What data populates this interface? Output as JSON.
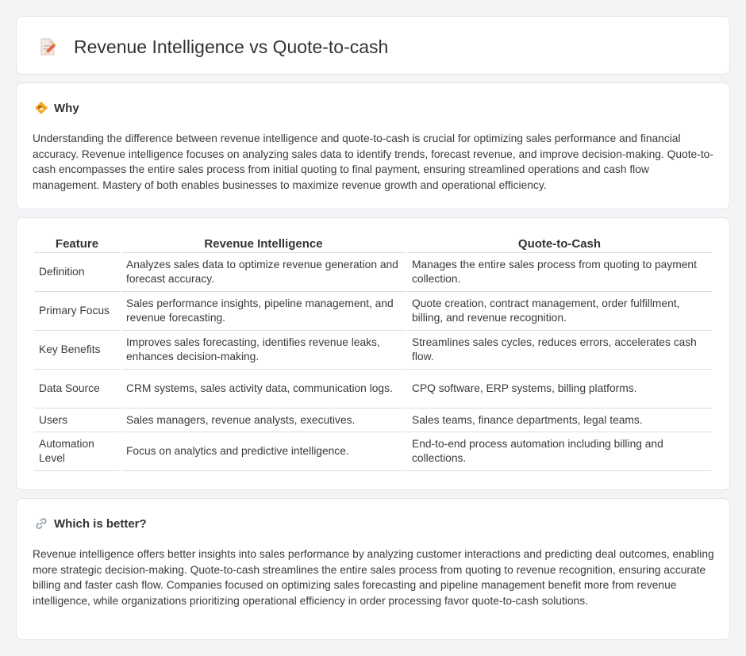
{
  "header": {
    "title": "Revenue Intelligence vs Quote-to-cash",
    "icon": "document-pencil-icon"
  },
  "why": {
    "title": "Why",
    "icon": "diamond-sign-icon",
    "text": "Understanding the difference between revenue intelligence and quote-to-cash is crucial for optimizing sales performance and financial accuracy. Revenue intelligence focuses on analyzing sales data to identify trends, forecast revenue, and improve decision-making. Quote-to-cash encompasses the entire sales process from initial quoting to final payment, ensuring streamlined operations and cash flow management. Mastery of both enables businesses to maximize revenue growth and operational efficiency."
  },
  "table": {
    "headers": [
      "Feature",
      "Revenue Intelligence",
      "Quote-to-Cash"
    ],
    "rows": [
      [
        "Definition",
        "Analyzes sales data to optimize revenue generation and forecast accuracy.",
        "Manages the entire sales process from quoting to payment collection."
      ],
      [
        "Primary Focus",
        "Sales performance insights, pipeline management, and revenue forecasting.",
        "Quote creation, contract management, order fulfillment, billing, and revenue recognition."
      ],
      [
        "Key Benefits",
        "Improves sales forecasting, identifies revenue leaks, enhances decision-making.",
        "Streamlines sales cycles, reduces errors, accelerates cash flow."
      ],
      [
        "Data Source",
        "CRM systems, sales activity data, communication logs.",
        "CPQ software, ERP systems, billing platforms."
      ],
      [
        "Users",
        "Sales managers, revenue analysts, executives.",
        "Sales teams, finance departments, legal teams."
      ],
      [
        "Automation Level",
        "Focus on analytics and predictive intelligence.",
        "End-to-end process automation including billing and collections."
      ]
    ]
  },
  "better": {
    "title": "Which is better?",
    "icon": "link-icon",
    "text": "Revenue intelligence offers better insights into sales performance by analyzing customer interactions and predicting deal outcomes, enabling more strategic decision-making. Quote-to-cash streamlines the entire sales process from quoting to revenue recognition, ensuring accurate billing and faster cash flow. Companies focused on optimizing sales forecasting and pipeline management benefit more from revenue intelligence, while organizations prioritizing operational efficiency in order processing favor quote-to-cash solutions."
  },
  "colors": {
    "background": "#f3f4f6",
    "card": "#ffffff",
    "text": "#333333",
    "icon_accent": "#f5a623",
    "icon_pencil": "#e8604c"
  }
}
